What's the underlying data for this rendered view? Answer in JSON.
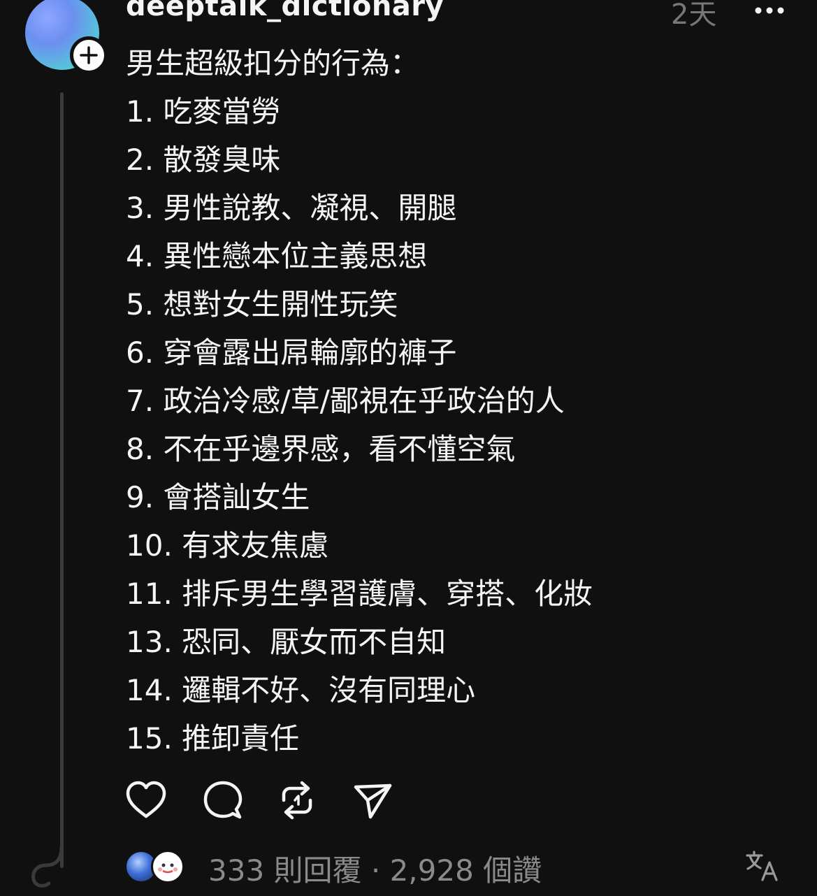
{
  "post": {
    "username": "deeptalk_dictionary",
    "timestamp": "2天",
    "lines": [
      "男生超級扣分的行為：",
      "1. 吃麥當勞",
      "2. 散發臭味",
      "3. 男性說教、凝視、開腿",
      "4. 異性戀本位主義思想",
      "5. 想對女生開性玩笑",
      "6. 穿會露出屌輪廓的褲子",
      "7. 政治冷感/草/鄙視在乎政治的人",
      "8. 不在乎邊界感，看不懂空氣",
      "9. 會搭訕女生",
      "10. 有求友焦慮",
      "11. 排斥男生學習護膚、穿搭、化妝",
      "13. 恐同、厭女而不自知",
      "14. 邏輯不好、沒有同理心",
      "15. 推卸責任"
    ]
  },
  "stats": {
    "text": "333 則回覆 · 2,928 個讚"
  },
  "icons": {
    "avatar": "profile-avatar",
    "follow": "plus-icon",
    "more": "more-dots-icon",
    "like": "heart-icon",
    "reply": "comment-bubble-icon",
    "repost": "repost-icon",
    "share": "send-icon",
    "translate": "translate-icon"
  },
  "colors": {
    "background": "#101010",
    "text": "#f3f5f7",
    "muted": "#8a8a8a",
    "thread_line": "#3a3a3a"
  }
}
